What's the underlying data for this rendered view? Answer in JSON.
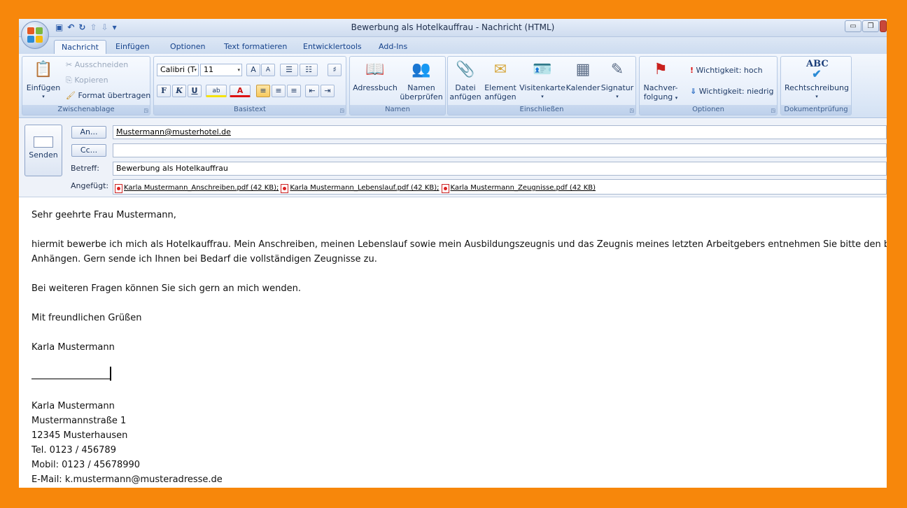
{
  "window": {
    "title": "Bewerbung als Hotelkauffrau - Nachricht (HTML)"
  },
  "quick_access": {
    "icons": [
      "save-icon",
      "undo-icon",
      "redo-icon",
      "arrow-up-icon",
      "arrow-down-icon",
      "customize-icon"
    ]
  },
  "tabs": [
    {
      "label": "Nachricht"
    },
    {
      "label": "Einfügen"
    },
    {
      "label": "Optionen"
    },
    {
      "label": "Text formatieren"
    },
    {
      "label": "Entwicklertools"
    },
    {
      "label": "Add-Ins"
    }
  ],
  "ribbon": {
    "clipboard": {
      "group_label": "Zwischenablage",
      "paste": "Einfügen",
      "cut": "Ausschneiden",
      "copy": "Kopieren",
      "format_painter": "Format übertragen"
    },
    "basic_text": {
      "group_label": "Basistext",
      "font": "Calibri (T",
      "size": "11",
      "grow": "A",
      "shrink": "A",
      "bold": "F",
      "italic": "K",
      "underline": "U",
      "highlight": "ab",
      "fontcolor": "A"
    },
    "names": {
      "group_label": "Namen",
      "address_book": "Adressbuch",
      "check_names_1": "Namen",
      "check_names_2": "überprüfen"
    },
    "include": {
      "group_label": "Einschließen",
      "attach_file_1": "Datei",
      "attach_file_2": "anfügen",
      "attach_item_1": "Element",
      "attach_item_2": "anfügen",
      "business_card": "Visitenkarte",
      "calendar": "Kalender",
      "signature": "Signatur"
    },
    "options": {
      "group_label": "Optionen",
      "followup_1": "Nachver-",
      "followup_2": "folgung",
      "importance_high": "Wichtigkeit: hoch",
      "importance_low": "Wichtigkeit: niedrig"
    },
    "proofing": {
      "group_label": "Dokumentprüfung",
      "spelling": "Rechtschreibung",
      "abc": "ABC"
    }
  },
  "header": {
    "send": "Senden",
    "to_button": "An...",
    "cc_button": "Cc...",
    "to_value": "Mustermann@musterhotel.de",
    "cc_value": "",
    "subject_label": "Betreff:",
    "subject_value": "Bewerbung als Hotelkauffrau",
    "attached_label": "Angefügt:",
    "attachments": [
      "Karla Mustermann_Anschreiben.pdf (42 KB);",
      "Karla Mustermann_Lebenslauf.pdf (42 KB);",
      "Karla Mustermann_Zeugnisse.pdf (42 KB)"
    ]
  },
  "body": {
    "greeting": "Sehr geehrte Frau Mustermann,",
    "para1_line1": "hiermit bewerbe ich mich als Hotelkauffrau. Mein Anschreiben, meinen Lebenslauf sowie mein Ausbildungszeugnis und das Zeugnis meines letzten Arbeitgebers entnehmen Sie bitte den beigefügten",
    "para1_line2": "Anhängen. Gern sende ich Ihnen bei Bedarf die vollständigen Zeugnisse zu.",
    "para2": "Bei weiteren Fragen können Sie sich gern an mich wenden.",
    "closing": "Mit freundlichen Grüßen",
    "name": "Karla Mustermann",
    "sig_name": "Karla Mustermann",
    "sig_street": "Mustermannstraße 1",
    "sig_city": "12345 Musterhausen",
    "sig_tel": "Tel. 0123 / 456789",
    "sig_mobile": "Mobil: 0123 / 45678990",
    "sig_email": "E-Mail: k.mustermann@musteradresse.de"
  }
}
